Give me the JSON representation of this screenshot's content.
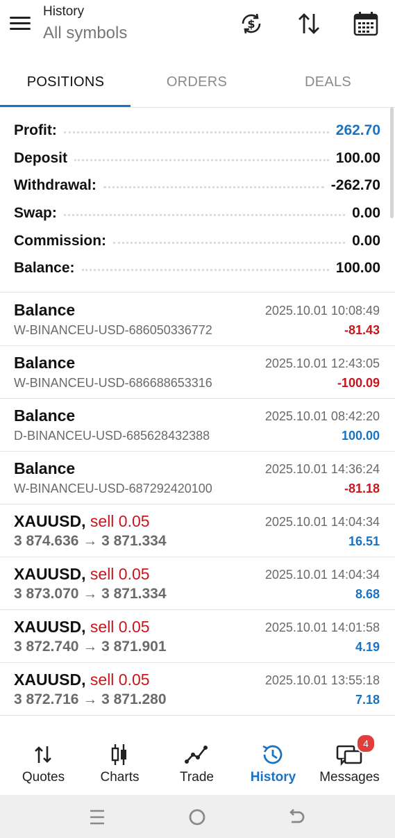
{
  "header": {
    "small_title": "History",
    "big_title": "All symbols"
  },
  "tabs": [
    {
      "label": "POSITIONS",
      "active": true
    },
    {
      "label": "ORDERS",
      "active": false
    },
    {
      "label": "DEALS",
      "active": false
    }
  ],
  "summary": [
    {
      "label": "Profit:",
      "value": "262.70"
    },
    {
      "label": "Deposit",
      "value": "100.00"
    },
    {
      "label": "Withdrawal:",
      "value": "-262.70"
    },
    {
      "label": "Swap:",
      "value": "0.00"
    },
    {
      "label": "Commission:",
      "value": "0.00"
    },
    {
      "label": "Balance:",
      "value": "100.00"
    }
  ],
  "records": [
    {
      "title": "Balance",
      "sub": "W-BINANCEU-USD-686050336772",
      "time": "2025.10.01 10:08:49",
      "value": "-81.43"
    },
    {
      "title": "Balance",
      "sub": "W-BINANCEU-USD-686688653316",
      "time": "2025.10.01 12:43:05",
      "value": "-100.09"
    },
    {
      "title": "Balance",
      "sub": "D-BINANCEU-USD-685628432388",
      "time": "2025.10.01 08:42:20",
      "value": "100.00"
    },
    {
      "title": "Balance",
      "sub": "W-BINANCEU-USD-687292420100",
      "time": "2025.10.01 14:36:24",
      "value": "-81.18"
    }
  ],
  "trades": [
    {
      "symbol": "XAUUSD,",
      "side": "sell 0.05",
      "prices": "3 874.636 → 3 871.334",
      "time": "2025.10.01 14:04:34",
      "value": "16.51"
    },
    {
      "symbol": "XAUUSD,",
      "side": "sell 0.05",
      "prices": "3 873.070 → 3 871.334",
      "time": "2025.10.01 14:04:34",
      "value": "8.68"
    },
    {
      "symbol": "XAUUSD,",
      "side": "sell 0.05",
      "prices": "3 872.740 → 3 871.901",
      "time": "2025.10.01 14:01:58",
      "value": "4.19"
    },
    {
      "symbol": "XAUUSD,",
      "side": "sell 0.05",
      "prices": "3 872.716 → 3 871.280",
      "time": "2025.10.01 13:55:18",
      "value": "7.18"
    }
  ],
  "nav": [
    {
      "label": "Quotes",
      "icon": "quotes-icon"
    },
    {
      "label": "Charts",
      "icon": "candlestick-icon"
    },
    {
      "label": "Trade",
      "icon": "trade-line-icon"
    },
    {
      "label": "History",
      "icon": "history-clock-icon",
      "active": true
    },
    {
      "label": "Messages",
      "icon": "messages-icon",
      "badge": "4"
    }
  ],
  "colors": {
    "accent": "#1a73c2",
    "negative": "#c8161d",
    "badge": "#e03d3d"
  }
}
